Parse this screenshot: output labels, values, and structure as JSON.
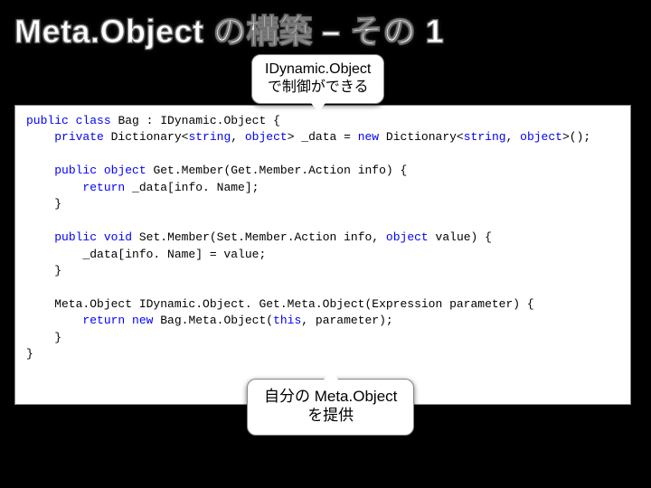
{
  "title": "Meta.Object の構築 – その 1",
  "callout_top": {
    "line1": "IDynamic.Object",
    "line2": "で制御ができる"
  },
  "callout_bottom": {
    "line1": "自分の Meta.Object",
    "line2": "を提供"
  },
  "code": {
    "l1_kw1": "public",
    "l1_kw2": "class",
    "l1_txt": " Bag : IDynamic.Object {",
    "l2_indent": "    ",
    "l2_kw1": "private",
    "l2_txt1": " Dictionary<",
    "l2_kw2": "string",
    "l2_txt2": ", ",
    "l2_kw3": "object",
    "l2_txt3": "> _data = ",
    "l2_kw4": "new",
    "l2_txt4": " Dictionary<",
    "l2_kw5": "string",
    "l2_txt5": ", ",
    "l2_kw6": "object",
    "l2_txt6": ">();",
    "l4_kw1": "public",
    "l4_kw2": "object",
    "l4_txt": " Get.Member(Get.Member.Action info) {",
    "l5_indent": "        ",
    "l5_kw": "return",
    "l5_txt": " _data[info. Name];",
    "l6": "    }",
    "l8_kw1": "public",
    "l8_kw2": "void",
    "l8_txt1": " Set.Member(Set.Member.Action info, ",
    "l8_kw3": "object",
    "l8_txt2": " value) {",
    "l9": "        _data[info. Name] = value;",
    "l10": "    }",
    "l12": "    Meta.Object IDynamic.Object. Get.Meta.Object(Expression parameter) {",
    "l13_indent": "        ",
    "l13_kw1": "return",
    "l13_kw2": "new",
    "l13_txt1": " Bag.Meta.Object(",
    "l13_kw3": "this",
    "l13_txt2": ", parameter);",
    "l14": "    }",
    "l15": "}"
  }
}
